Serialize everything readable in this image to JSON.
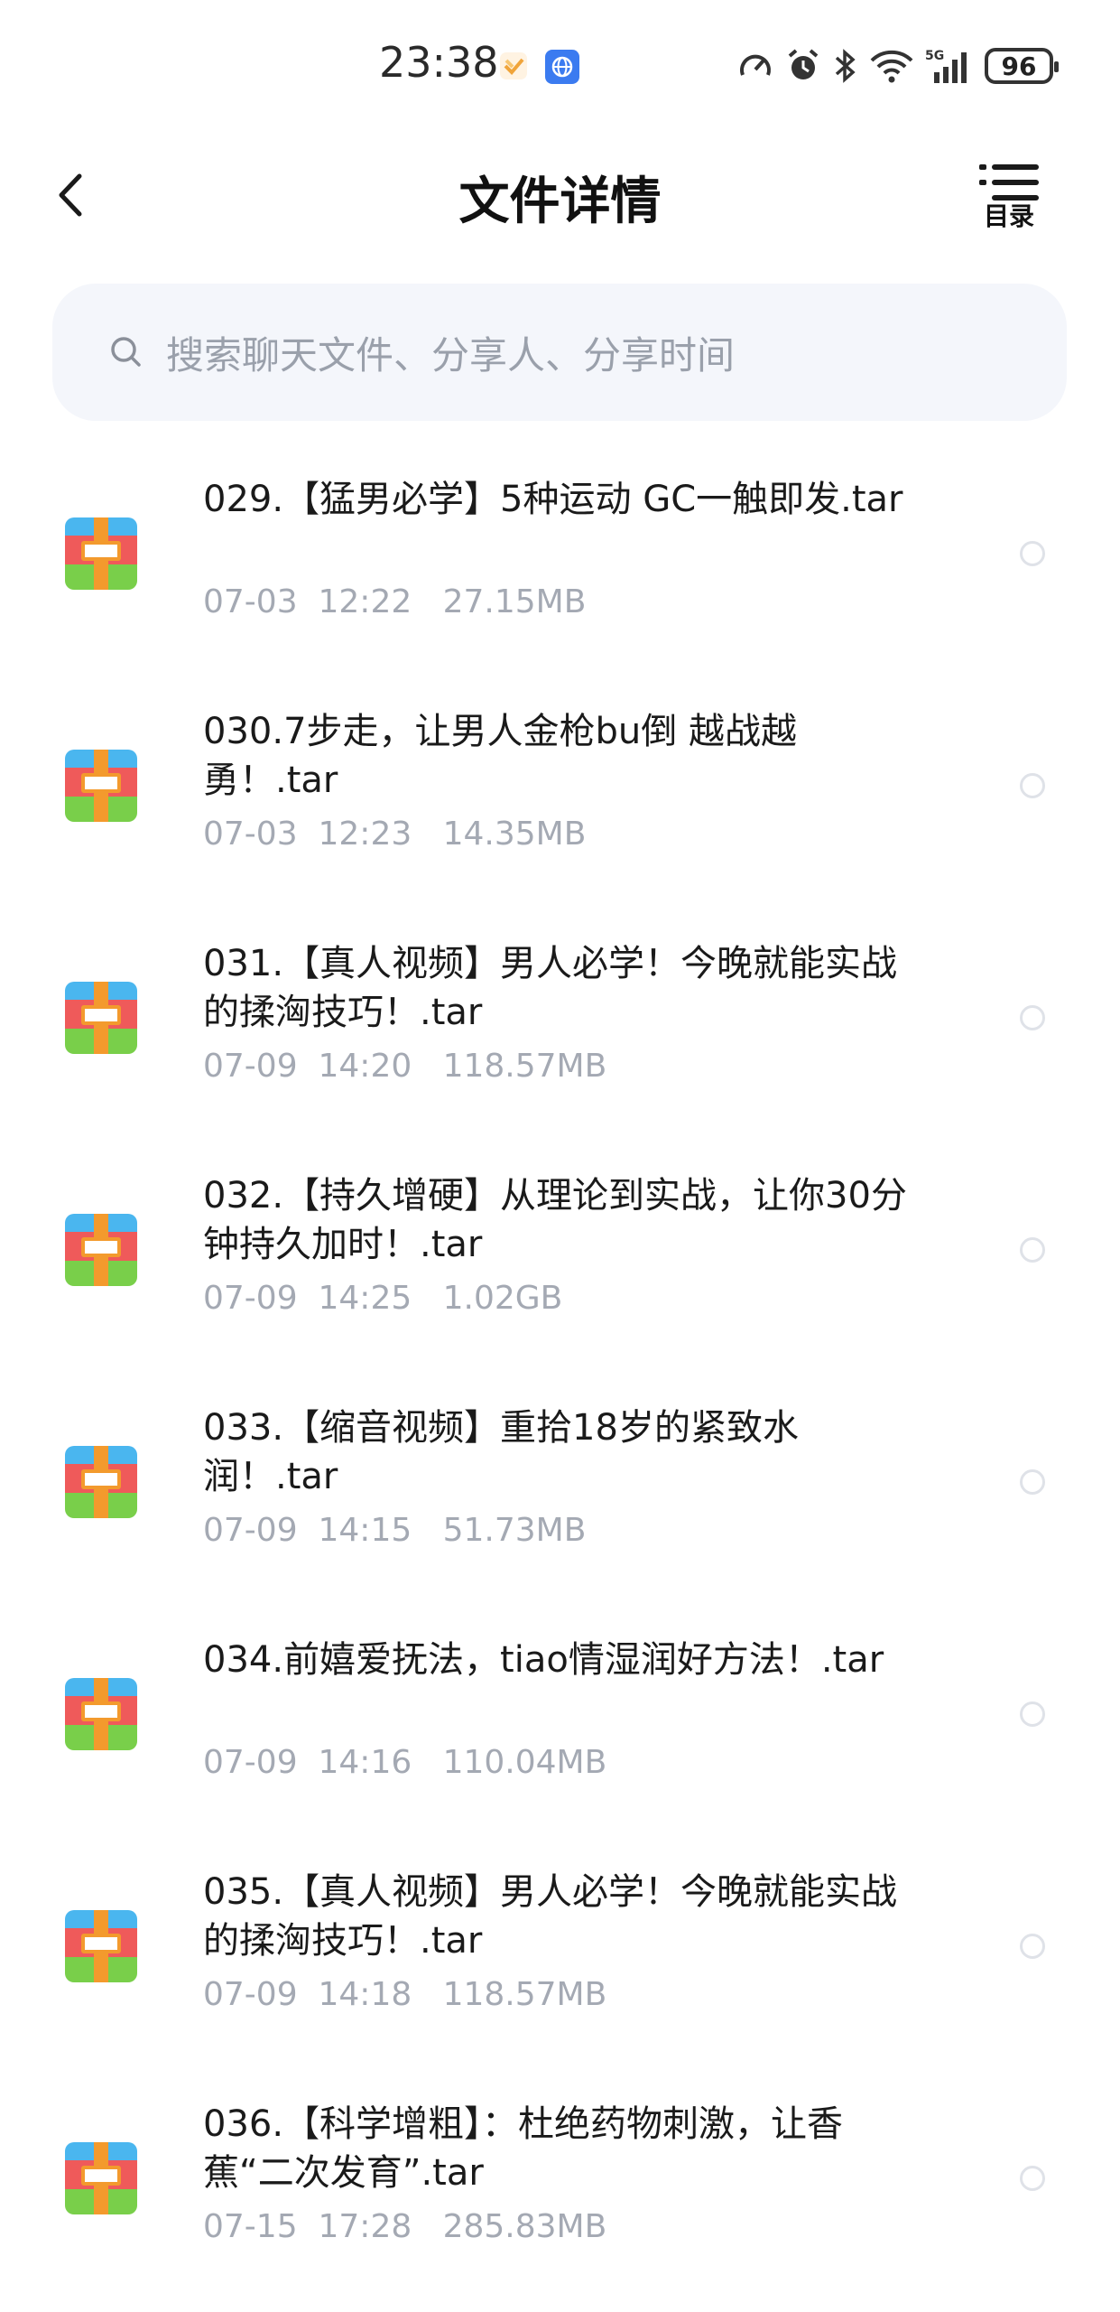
{
  "status_bar": {
    "time": "23:38",
    "battery": "96",
    "icons": [
      "note-icon",
      "globe-icon",
      "speed-icon",
      "alarm-icon",
      "bluetooth-icon",
      "wifi-icon",
      "signal-5g-icon",
      "battery-icon"
    ]
  },
  "header": {
    "title": "文件详情",
    "toc_label": "目录"
  },
  "search": {
    "placeholder": "搜索聊天文件、分享人、分享时间"
  },
  "files": [
    {
      "name": "029.【猛男必学】5种运动 GC一触即发.tar",
      "date": "07-03",
      "time": "12:22",
      "size": "27.15MB"
    },
    {
      "name": "030.7步走，让男人金枪bu倒 越战越勇！.tar",
      "date": "07-03",
      "time": "12:23",
      "size": "14.35MB"
    },
    {
      "name": "031.【真人视频】男人必学！今晚就能实战的揉洶技巧！.tar",
      "date": "07-09",
      "time": "14:20",
      "size": "118.57MB"
    },
    {
      "name": "032.【持久增硬】从理论到实战，让你30分钟持久加时！.tar",
      "date": "07-09",
      "time": "14:25",
      "size": "1.02GB"
    },
    {
      "name": "033.【缩音视频】重拾18岁的紧致水润！.tar",
      "date": "07-09",
      "time": "14:15",
      "size": "51.73MB"
    },
    {
      "name": "034.前嬉爱抚法，tiao情湿润好方法！.tar",
      "date": "07-09",
      "time": "14:16",
      "size": "110.04MB"
    },
    {
      "name": "035.【真人视频】男人必学！今晚就能实战的揉洶技巧！.tar",
      "date": "07-09",
      "time": "14:18",
      "size": "118.57MB"
    },
    {
      "name": "036.【科学增粗】：杜绝药物刺激，让香蕉“二次发育”.tar",
      "date": "07-15",
      "time": "17:28",
      "size": "285.83MB"
    }
  ]
}
